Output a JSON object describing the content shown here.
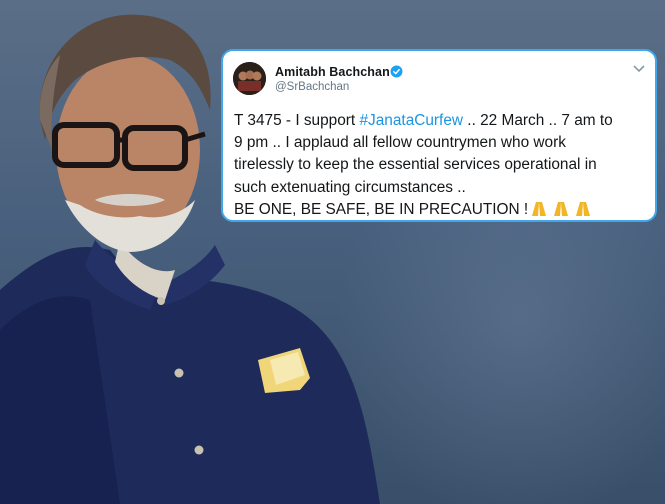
{
  "tweet": {
    "author_name": "Amitabh Bachchan",
    "author_handle": "@SrBachchan",
    "verified_icon": "verified-badge-icon",
    "menu_icon": "chevron-down-icon",
    "lines": {
      "line1_before": "T 3475 - I support ",
      "hashtag": "#JanataCurfew",
      "line1_after": " .. 22 March .. 7 am to",
      "line2": "9 pm .. I applaud all fellow countrymen who work",
      "line3": "tirelessly to keep the essential services operational in",
      "line4": "such extenuating circumstances ..",
      "line5": "BE ONE, BE SAFE, BE IN PRECAUTION !"
    },
    "emoji_icon": "folded-hands-icon",
    "colors": {
      "border": "#41a7e8",
      "hashtag": "#1b95e0",
      "verified": "#1da1f2"
    }
  }
}
